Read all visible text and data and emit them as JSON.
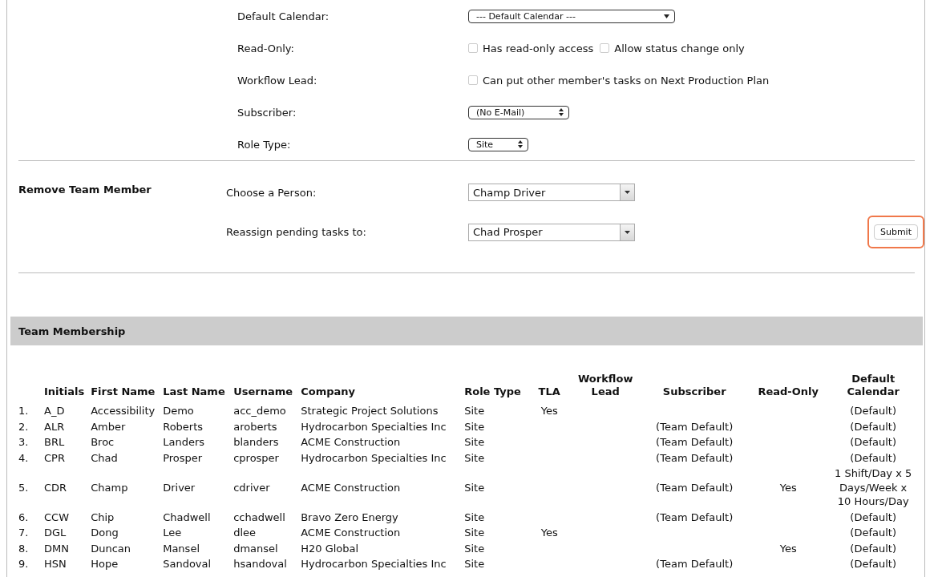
{
  "settings": {
    "rows": [
      {
        "label": "Default Calendar:",
        "kind": "popup",
        "value": "--- Default Calendar ---"
      },
      {
        "label": "Read-Only:",
        "kind": "checkboxes",
        "options": [
          {
            "label": "Has read-only access",
            "checked": false
          },
          {
            "label": "Allow status change only",
            "checked": false
          }
        ]
      },
      {
        "label": "Workflow Lead:",
        "kind": "checkboxes",
        "options": [
          {
            "label": "Can put other member's tasks on Next Production Plan",
            "checked": false
          }
        ]
      },
      {
        "label": "Subscriber:",
        "kind": "stepper",
        "value": "(No E-Mail)"
      },
      {
        "label": "Role Type:",
        "kind": "stepper",
        "value": "Site"
      }
    ]
  },
  "remove_member": {
    "title": "Remove Team Member",
    "fields": [
      {
        "label": "Choose a Person:",
        "value": "Champ Driver"
      },
      {
        "label": "Reassign pending tasks to:",
        "value": "Chad Prosper"
      }
    ],
    "submit": {
      "label": "Submit",
      "highlighted": true
    }
  },
  "team_membership": {
    "title": "Team Membership",
    "columns": [
      "",
      "Initials",
      "First Name",
      "Last Name",
      "Username",
      "Company",
      "Role Type",
      "TLA",
      "Workflow Lead",
      "Subscriber",
      "Read-Only",
      "Default Calendar"
    ],
    "rows": [
      [
        "1.",
        "A_D",
        "Accessibility",
        "Demo",
        "acc_demo",
        "Strategic Project Solutions",
        "Site",
        "Yes",
        "",
        "",
        "",
        "(Default)"
      ],
      [
        "2.",
        "ALR",
        "Amber",
        "Roberts",
        "aroberts",
        "Hydrocarbon Specialties Inc",
        "Site",
        "",
        "",
        "(Team Default)",
        "",
        "(Default)"
      ],
      [
        "3.",
        "BRL",
        "Broc",
        "Landers",
        "blanders",
        "ACME Construction",
        "Site",
        "",
        "",
        "(Team Default)",
        "",
        "(Default)"
      ],
      [
        "4.",
        "CPR",
        "Chad",
        "Prosper",
        "cprosper",
        "Hydrocarbon Specialties Inc",
        "Site",
        "",
        "",
        "(Team Default)",
        "",
        "(Default)"
      ],
      [
        "5.",
        "CDR",
        "Champ",
        "Driver",
        "cdriver",
        "ACME Construction",
        "Site",
        "",
        "",
        "(Team Default)",
        "Yes",
        "1 Shift/Day x 5 Days/Week x 10 Hours/Day"
      ],
      [
        "6.",
        "CCW",
        "Chip",
        "Chadwell",
        "cchadwell",
        "Bravo Zero Energy",
        "Site",
        "",
        "",
        "(Team Default)",
        "",
        "(Default)"
      ],
      [
        "7.",
        "DGL",
        "Dong",
        "Lee",
        "dlee",
        "ACME Construction",
        "Site",
        "Yes",
        "",
        "",
        "",
        "(Default)"
      ],
      [
        "8.",
        "DMN",
        "Duncan",
        "Mansel",
        "dmansel",
        "H20 Global",
        "Site",
        "",
        "",
        "",
        "Yes",
        "(Default)"
      ],
      [
        "9.",
        "HSN",
        "Hope",
        "Sandoval",
        "hsandoval",
        "Hydrocarbon Specialties Inc",
        "Site",
        "",
        "",
        "(Team Default)",
        "",
        "(Default)"
      ]
    ]
  }
}
